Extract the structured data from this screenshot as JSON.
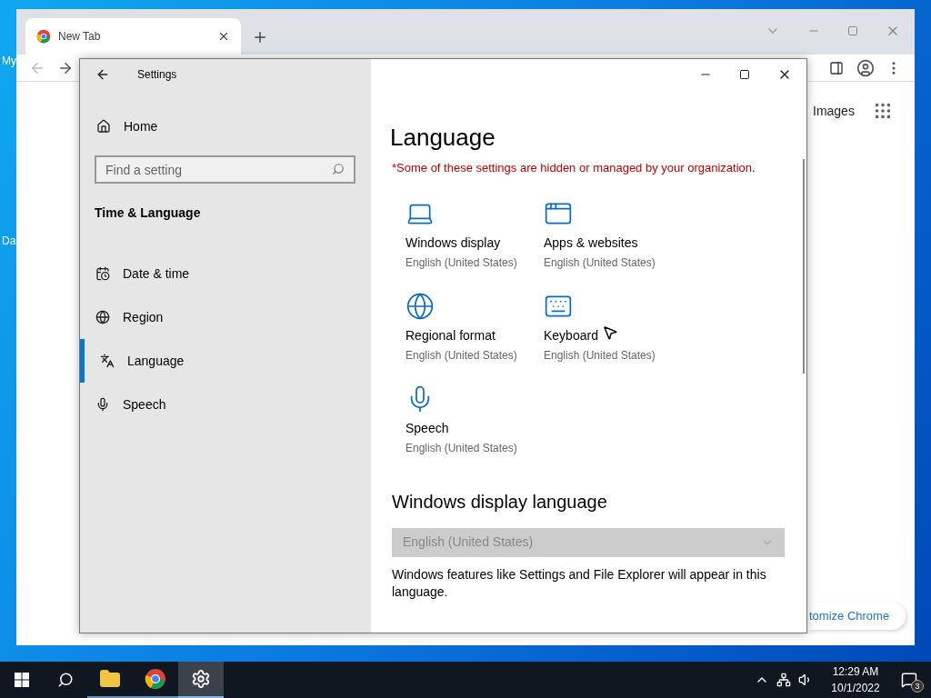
{
  "desktop": {
    "icon_labels": [
      "My",
      "Da"
    ]
  },
  "browser": {
    "tabs": [
      {
        "title": "New Tab",
        "selected": true
      }
    ],
    "apps_link": "Images",
    "customize_button": "tomize Chrome"
  },
  "settings": {
    "title": "Settings",
    "home": "Home",
    "search": {
      "placeholder": "Find a setting"
    },
    "section": "Time & Language",
    "nav": [
      {
        "label": "Date & time",
        "kind": "calendar",
        "selected": false
      },
      {
        "label": "Region",
        "kind": "globe",
        "selected": false
      },
      {
        "label": "Language",
        "kind": "language",
        "selected": true
      },
      {
        "label": "Speech",
        "kind": "microphone",
        "selected": false
      }
    ],
    "heading": "Language",
    "notice": "*Some of these settings are hidden or managed by your organization.",
    "items": [
      {
        "title": "Windows display",
        "subtitle": "English (United States)",
        "kind": "laptop"
      },
      {
        "title": "Apps & websites",
        "subtitle": "English (United States)",
        "kind": "window"
      },
      {
        "title": "Regional format",
        "subtitle": "English (United States)",
        "kind": "globe"
      },
      {
        "title": "Keyboard",
        "subtitle": "English (United States)",
        "kind": "keyboard"
      },
      {
        "title": "Speech",
        "subtitle": "English (United States)",
        "kind": "microphone"
      }
    ],
    "display_language": {
      "heading": "Windows display language",
      "value": "English (United States)",
      "disabled": true,
      "description": "Windows features like Settings and File Explorer will appear in this language."
    }
  },
  "taskbar": {
    "apps": [
      {
        "kind": "folder",
        "selected": false
      },
      {
        "kind": "chrome",
        "selected": false
      },
      {
        "kind": "gear",
        "selected": true
      }
    ],
    "time": "12:29 AM",
    "date": "10/1/2022",
    "notifications": "3"
  }
}
